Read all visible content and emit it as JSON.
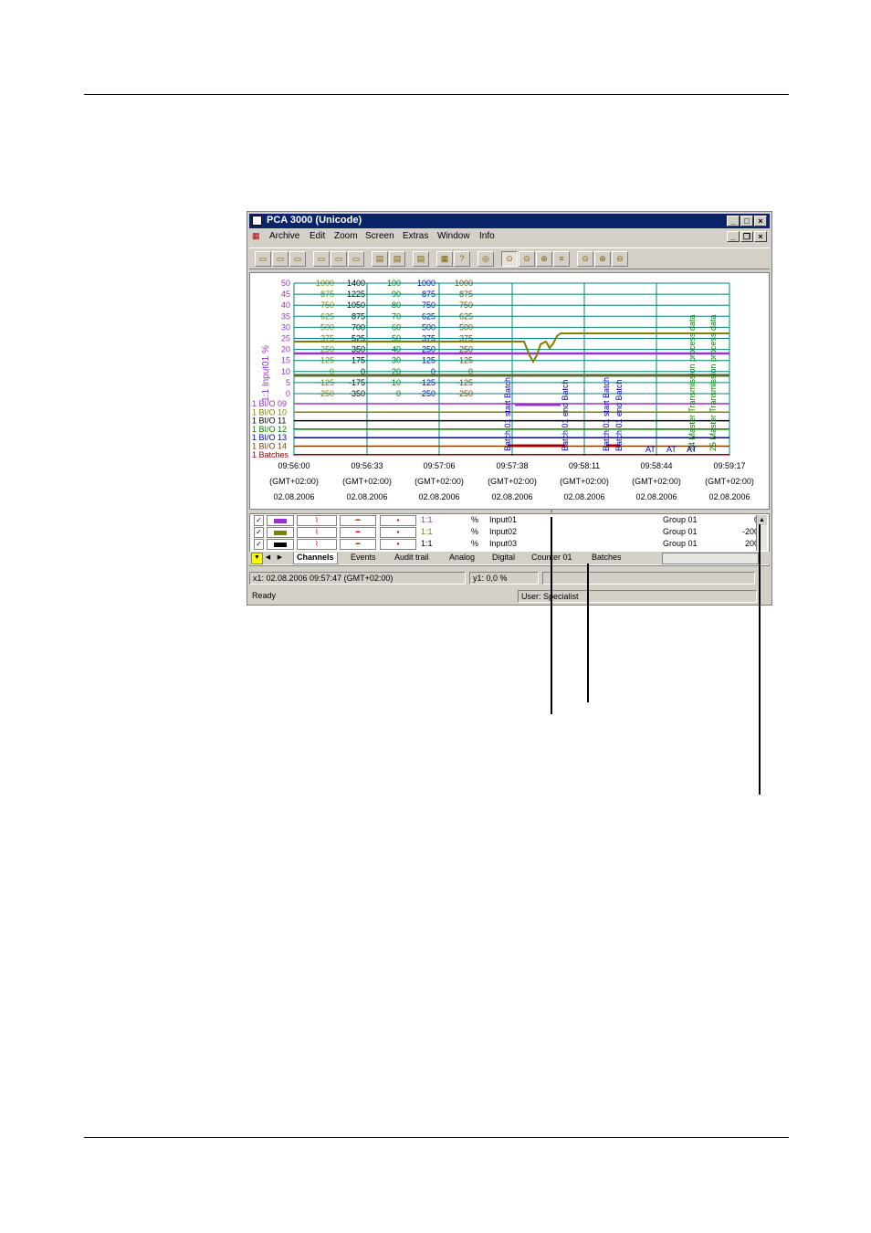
{
  "window": {
    "title": "PCA 3000 (Unicode)",
    "controls": [
      "_",
      "□",
      "×"
    ],
    "mdi_controls": [
      "_",
      "❐",
      "×"
    ]
  },
  "menu": [
    "Archive",
    "Edit",
    "Zoom",
    "Screen",
    "Extras",
    "Window",
    "Info"
  ],
  "chart": {
    "y_axis_label": "1:1 Input01 %",
    "scales": [
      {
        "color": "#9932cc",
        "values": [
          "50",
          "45",
          "40",
          "35",
          "30",
          "25",
          "20",
          "15",
          "10",
          "5",
          "0"
        ]
      },
      {
        "color": "#808000",
        "values": [
          "1000",
          "875",
          "750",
          "625",
          "500",
          "375",
          "250",
          "125",
          "0",
          "-125",
          "-250"
        ]
      },
      {
        "color": "#000000",
        "values": [
          "1400",
          "1225",
          "1050",
          "875",
          "700",
          "525",
          "350",
          "175",
          "0",
          "-175",
          "-350"
        ]
      },
      {
        "color": "#008000",
        "values": [
          "100",
          "90",
          "80",
          "70",
          "60",
          "50",
          "40",
          "30",
          "20",
          "10",
          "0"
        ]
      },
      {
        "color": "#0000c0",
        "values": [
          "1000",
          "875",
          "750",
          "625",
          "500",
          "375",
          "250",
          "125",
          "0",
          "-125",
          "-250"
        ]
      },
      {
        "color": "#804000",
        "values": [
          "1000",
          "875",
          "750",
          "625",
          "500",
          "375",
          "250",
          "125",
          "0",
          "-125",
          "-250"
        ]
      }
    ],
    "digital_labels": [
      "1 BI/O 09",
      "1 BI/O 10",
      "1 BI/O 11",
      "1 BI/O 12",
      "1 BI/O 13",
      "1 BI/O 14",
      "1 Batches"
    ],
    "x_ticks": [
      {
        "time": "09:56:00",
        "tz": "(GMT+02:00)",
        "date": "02.08.2006"
      },
      {
        "time": "09:56:33",
        "tz": "(GMT+02:00)",
        "date": "02.08.2006"
      },
      {
        "time": "09:57:06",
        "tz": "(GMT+02:00)",
        "date": "02.08.2006"
      },
      {
        "time": "09:57:38",
        "tz": "(GMT+02:00)",
        "date": "02.08.2006"
      },
      {
        "time": "09:58:11",
        "tz": "(GMT+02:00)",
        "date": "02.08.2006"
      },
      {
        "time": "09:58:44",
        "tz": "(GMT+02:00)",
        "date": "02.08.2006"
      },
      {
        "time": "09:59:17",
        "tz": "(GMT+02:00)",
        "date": "02.08.2006"
      }
    ],
    "event_labels": [
      "Batch 01 start Batch",
      "Batch 01 end Batch",
      "Batch 01 start Batch",
      "Batch 01 end Batch",
      "24 Master Transmission process data",
      "25 Master Transmission process data"
    ],
    "marker_labels": [
      "AT",
      "AT",
      "AT"
    ]
  },
  "channels": [
    {
      "color": "#9932cc",
      "factor": "1:1",
      "unit": "%",
      "name": "Input01",
      "group": "Group 01",
      "value": "0"
    },
    {
      "color": "#808000",
      "factor": "1:1",
      "unit": "%",
      "name": "Input02",
      "group": "Group 01",
      "value": "-200"
    },
    {
      "color": "#000000",
      "factor": "1:1",
      "unit": "%",
      "name": "Input03",
      "group": "Group 01",
      "value": "200"
    }
  ],
  "tabs": [
    "Channels",
    "Events",
    "Audit trail",
    "Analog",
    "Digital",
    "Counter 01",
    "Batches"
  ],
  "cursor": {
    "x": "x1: 02.08.2006 09:57:47 (GMT+02:00)",
    "y": "y1: 0,0 %"
  },
  "status": {
    "left": "Ready",
    "user": "User: Specialist"
  }
}
